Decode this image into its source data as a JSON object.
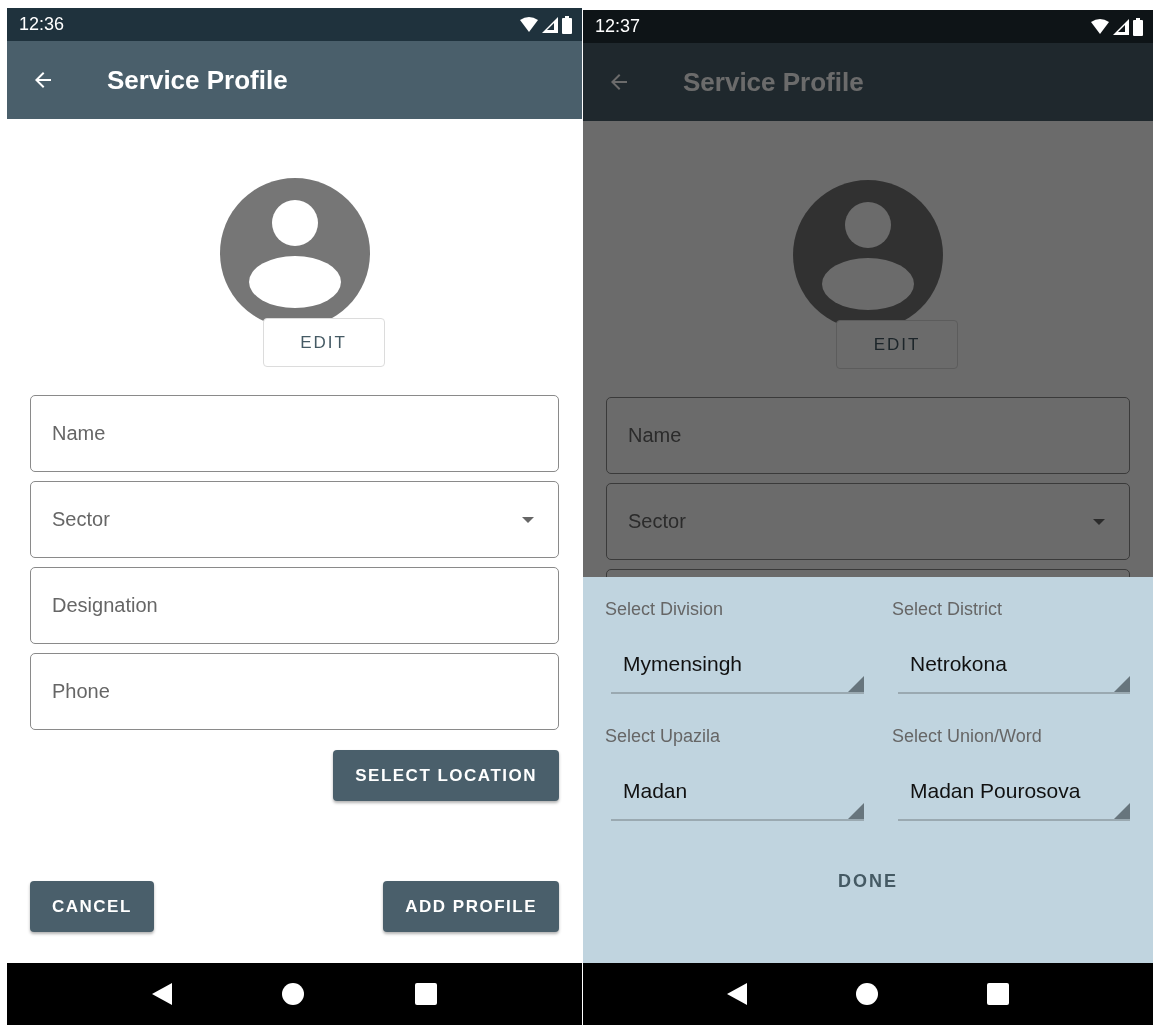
{
  "screens": [
    {
      "status_bar": {
        "time": "12:36"
      },
      "app_bar": {
        "title": "Service Profile"
      },
      "dimmed": false,
      "form": {
        "edit_button": "EDIT",
        "fields": [
          {
            "kind": "text",
            "placeholder": "Name"
          },
          {
            "kind": "dropdown",
            "placeholder": "Sector"
          },
          {
            "kind": "text",
            "placeholder": "Designation"
          },
          {
            "kind": "text",
            "placeholder": "Phone"
          }
        ],
        "select_location_button": "SELECT LOCATION",
        "cancel_button": "CANCEL",
        "add_profile_button": "ADD PROFILE"
      }
    },
    {
      "status_bar": {
        "time": "12:37"
      },
      "app_bar": {
        "title": "Service Profile"
      },
      "dimmed": true,
      "form": {
        "edit_button": "EDIT",
        "fields": [
          {
            "kind": "text",
            "placeholder": "Name"
          },
          {
            "kind": "dropdown",
            "placeholder": "Sector"
          },
          {
            "kind": "text"
          }
        ]
      },
      "location_sheet": {
        "selects": [
          {
            "label": "Select Division",
            "value": "Mymensingh"
          },
          {
            "label": "Select District",
            "value": "Netrokona"
          },
          {
            "label": "Select Upazila",
            "value": "Madan"
          },
          {
            "label": "Select Union/Word",
            "value": "Madan Pourosova"
          }
        ],
        "done_button": "DONE"
      }
    }
  ]
}
